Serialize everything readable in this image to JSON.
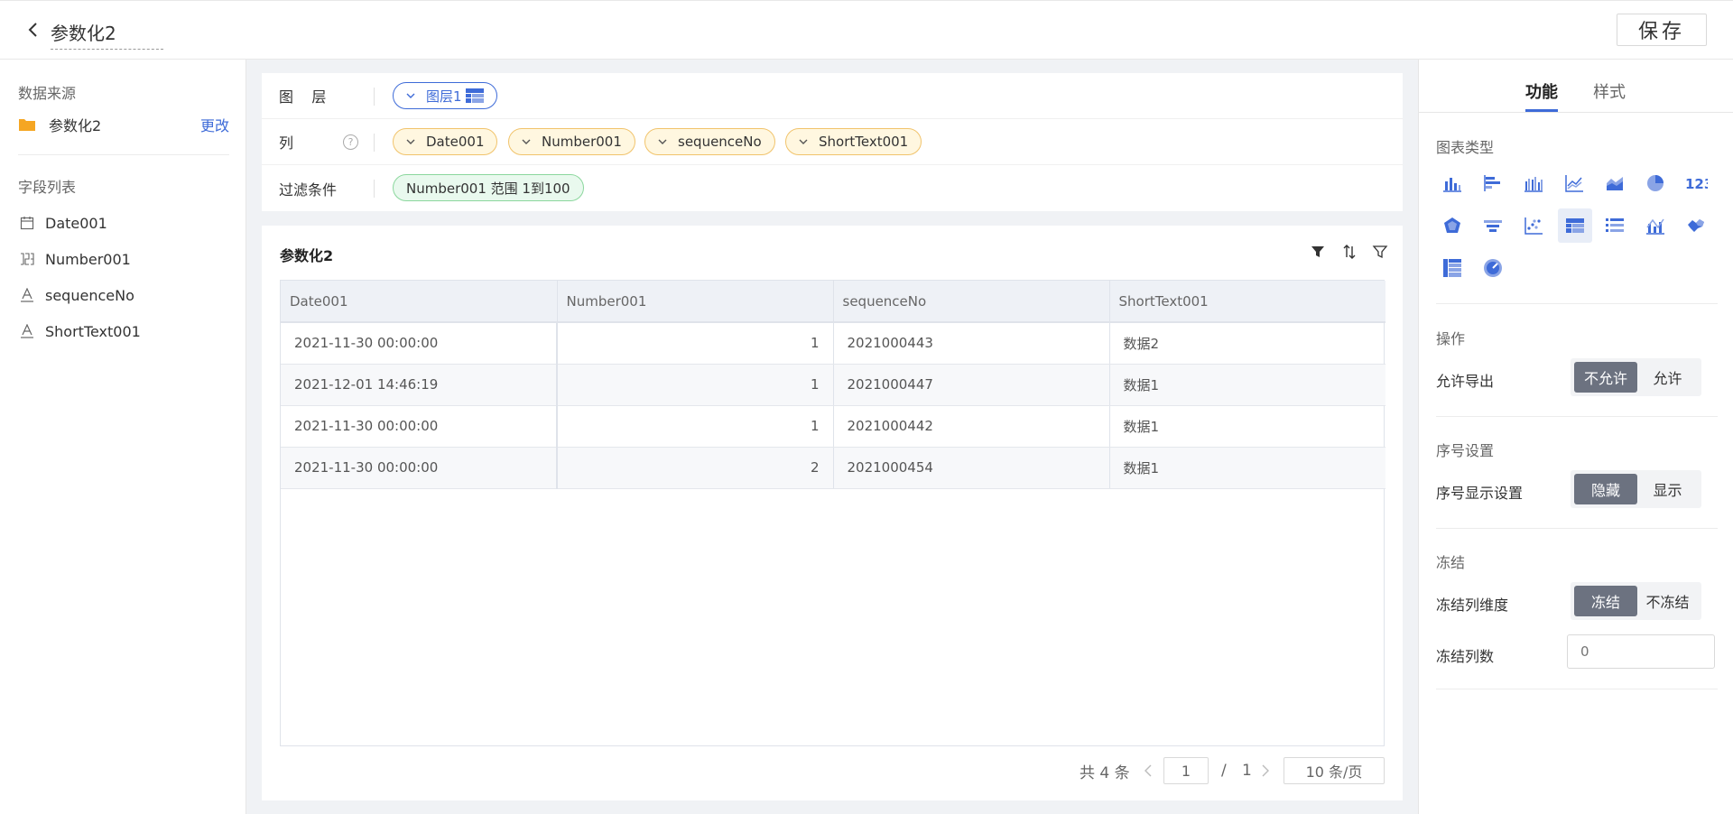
{
  "header": {
    "title": "参数化2",
    "save_label": "保存"
  },
  "sidebar": {
    "datasource_title": "数据来源",
    "datasource_name": "参数化2",
    "change_label": "更改",
    "fields_title": "字段列表",
    "fields": [
      {
        "label": "Date001",
        "icon": "calendar-icon"
      },
      {
        "label": "Number001",
        "icon": "number-icon"
      },
      {
        "label": "sequenceNo",
        "icon": "text-icon"
      },
      {
        "label": "ShortText001",
        "icon": "text-icon"
      }
    ]
  },
  "config": {
    "layer_label": "图    层",
    "layer_pill": "图层1",
    "columns_label": "列",
    "columns": [
      "Date001",
      "Number001",
      "sequenceNo",
      "ShortText001"
    ],
    "filter_label": "过滤条件",
    "filter_pill": "Number001 范围 1到100"
  },
  "table": {
    "title": "参数化2",
    "headers": [
      "Date001",
      "Number001",
      "sequenceNo",
      "ShortText001"
    ],
    "rows": [
      [
        "2021-11-30 00:00:00",
        "1",
        "2021000443",
        "数据2"
      ],
      [
        "2021-12-01 14:46:19",
        "1",
        "2021000447",
        "数据1"
      ],
      [
        "2021-11-30 00:00:00",
        "1",
        "2021000442",
        "数据1"
      ],
      [
        "2021-11-30 00:00:00",
        "2",
        "2021000454",
        "数据1"
      ]
    ]
  },
  "pagination": {
    "total": "共 4 条",
    "page": "1",
    "separator": "/",
    "pages": "1",
    "page_size": "10 条/页"
  },
  "right_panel": {
    "tabs": [
      "功能",
      "样式"
    ],
    "chart_type_title": "图表类型",
    "ops_title": "操作",
    "allow_export_label": "允许导出",
    "allow_export_options": [
      "不允许",
      "允许"
    ],
    "seq_title": "序号设置",
    "seq_display_label": "序号显示设置",
    "seq_display_options": [
      "隐藏",
      "显示"
    ],
    "freeze_title": "冻结",
    "freeze_dim_label": "冻结列维度",
    "freeze_dim_options": [
      "冻结",
      "不冻结"
    ],
    "freeze_count_label": "冻结列数",
    "freeze_count_placeholder": "0"
  },
  "colors": {
    "accent": "#3e6bd8",
    "segment_active": "#6c7280"
  }
}
